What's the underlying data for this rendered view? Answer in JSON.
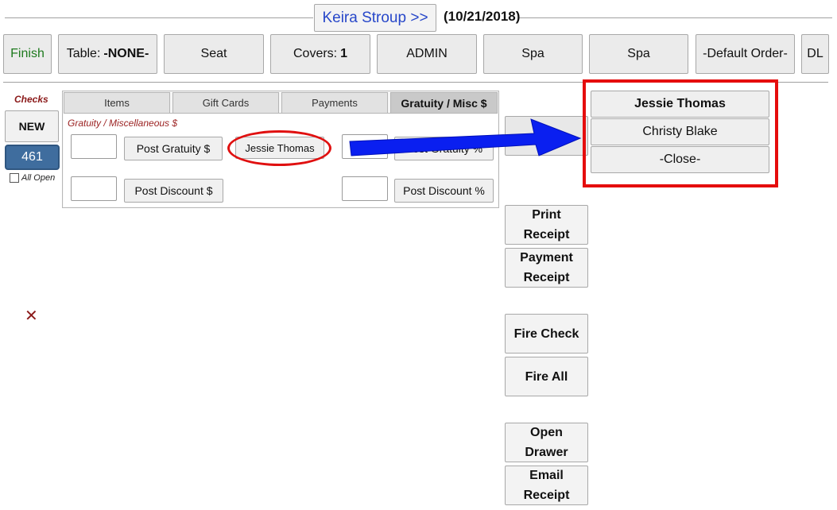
{
  "header": {
    "server_name": "Keira Stroup >>",
    "date": "(10/21/2018)"
  },
  "toolbar": {
    "finish": "Finish",
    "table_label": "Table:",
    "table_value": "-NONE-",
    "seat": "Seat",
    "covers_label": "Covers:",
    "covers_value": "1",
    "admin": "ADMIN",
    "spa_1": "Spa",
    "spa_2": "Spa",
    "default_order": "-Default Order-",
    "dl": "DL"
  },
  "checks": {
    "label": "Checks",
    "new_button": "NEW",
    "check_number": "461",
    "all_open_label": "All Open",
    "delete_glyph": "✕"
  },
  "tabs": [
    {
      "label": "Items",
      "active": false
    },
    {
      "label": "Gift Cards",
      "active": false
    },
    {
      "label": "Payments",
      "active": false
    },
    {
      "label": "Gratuity / Misc $",
      "active": true
    }
  ],
  "gratuity": {
    "section_label": "Gratuity / Miscellaneous $",
    "post_gratuity_amount": "Post Gratuity $",
    "employee_button": "Jessie Thomas",
    "post_gratuity_percent": "Post Gratuity %",
    "post_discount_amount": "Post Discount $",
    "post_discount_percent": "Post Discount %",
    "gratuity_amount_value": "",
    "gratuity_percent_value": "",
    "discount_amount_value": "",
    "discount_percent_value": ""
  },
  "employee_popup": {
    "options": [
      "Jessie Thomas",
      "Christy Blake"
    ],
    "close": "-Close-"
  },
  "side_actions": {
    "print_receipt": [
      "Print",
      "Receipt"
    ],
    "payment_receipt": [
      "Payment",
      "Receipt"
    ],
    "fire_check": "Fire Check",
    "fire_all": "Fire All",
    "open_drawer": [
      "Open",
      "Drawer"
    ],
    "email_receipt": [
      "Email",
      "Receipt"
    ]
  },
  "colors": {
    "finish_text": "#1e7a1e",
    "server_text": "#2747c9",
    "annotation_red": "#e01010",
    "annotation_blue": "#0a1ff0",
    "check_selected": "#3f6d9e",
    "label_red": "#8b1a1a"
  },
  "icons": {
    "arrow": "blue-arrow-annotation",
    "delete": "delete-x-icon",
    "checkbox": "checkbox-icon"
  }
}
